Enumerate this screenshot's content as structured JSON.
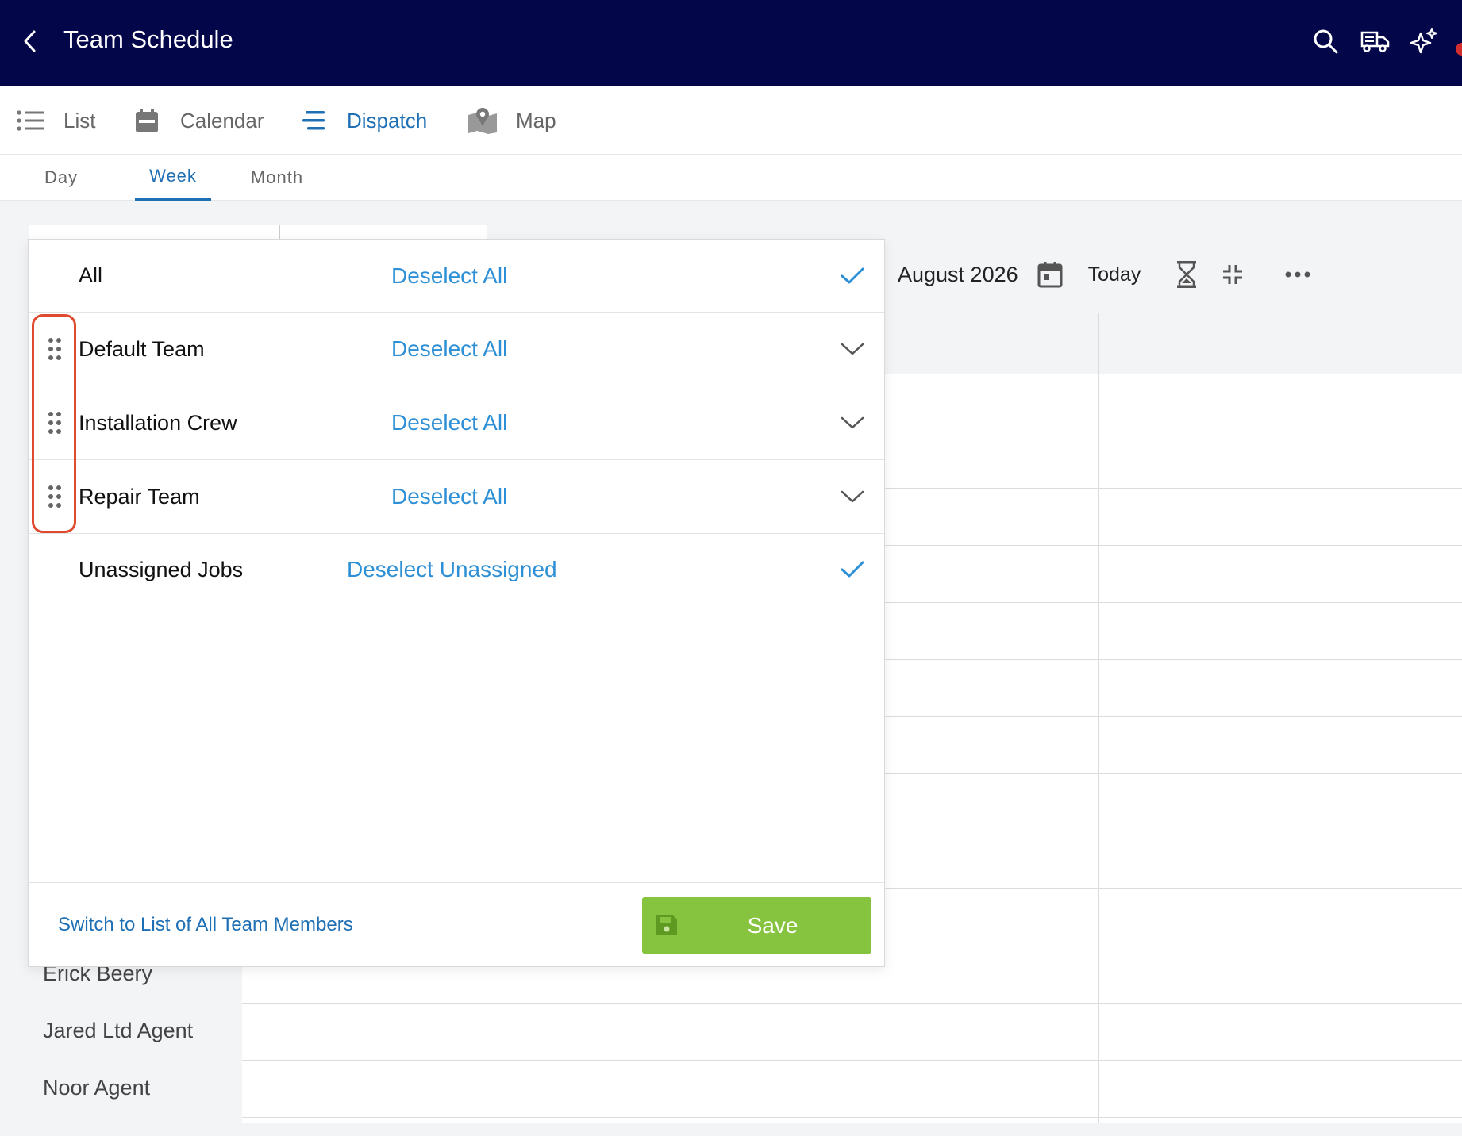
{
  "header": {
    "title": "Team Schedule",
    "icons": [
      "back-icon",
      "search-icon",
      "truck-icon",
      "sparkle-icon"
    ]
  },
  "view_tabs": [
    {
      "label": "List",
      "icon": "list-icon",
      "active": false
    },
    {
      "label": "Calendar",
      "icon": "calendar-icon",
      "active": false
    },
    {
      "label": "Dispatch",
      "icon": "dispatch-icon",
      "active": true
    },
    {
      "label": "Map",
      "icon": "map-icon",
      "active": false
    }
  ],
  "range_tabs": [
    {
      "label": "Day",
      "active": false
    },
    {
      "label": "Week",
      "active": true
    },
    {
      "label": "Month",
      "active": false
    }
  ],
  "toolbar": {
    "month": "August 2026",
    "today": "Today"
  },
  "team_filter": {
    "rows": [
      {
        "name": "All",
        "action": "Deselect All",
        "state": "checked",
        "draggable": false
      },
      {
        "name": "Default Team",
        "action": "Deselect All",
        "state": "collapsed",
        "draggable": true
      },
      {
        "name": "Installation Crew",
        "action": "Deselect All",
        "state": "collapsed",
        "draggable": true
      },
      {
        "name": "Repair Team",
        "action": "Deselect All",
        "state": "collapsed",
        "draggable": true
      },
      {
        "name": "Unassigned Jobs",
        "action": "Deselect Unassigned",
        "state": "checked",
        "draggable": false
      }
    ],
    "switch_link": "Switch to List of All Team Members",
    "save_label": "Save"
  },
  "members": [
    "Erick Beery",
    "Jared Ltd Agent",
    "Noor Agent"
  ],
  "colors": {
    "header_bg": "#04064a",
    "accent_blue": "#1f6fb5",
    "link_blue": "#2d8fd5",
    "save_green": "#86c33e",
    "highlight_red": "#e04a2e"
  }
}
